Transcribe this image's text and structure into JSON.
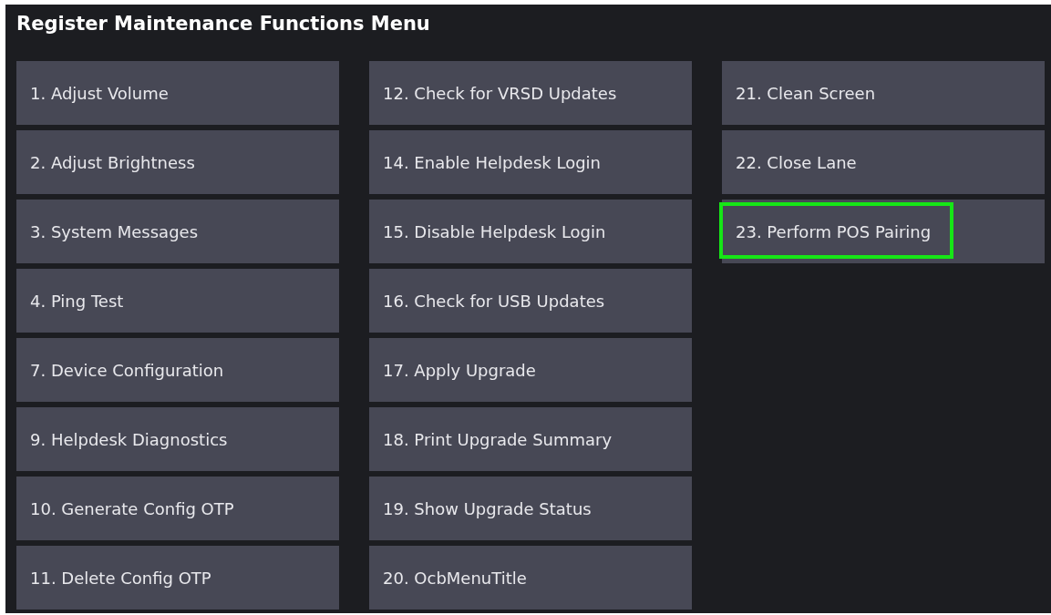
{
  "title": "Register Maintenance Functions Menu",
  "columns": [
    {
      "items": [
        {
          "label": "1. Adjust Volume",
          "highlighted": false
        },
        {
          "label": "2. Adjust Brightness",
          "highlighted": false
        },
        {
          "label": "3. System Messages",
          "highlighted": false
        },
        {
          "label": "4. Ping Test",
          "highlighted": false
        },
        {
          "label": "7. Device Configuration",
          "highlighted": false
        },
        {
          "label": "9. Helpdesk Diagnostics",
          "highlighted": false
        },
        {
          "label": "10. Generate Config OTP",
          "highlighted": false
        },
        {
          "label": "11. Delete Config OTP",
          "highlighted": false
        }
      ]
    },
    {
      "items": [
        {
          "label": "12. Check for VRSD Updates",
          "highlighted": false
        },
        {
          "label": "14. Enable Helpdesk Login",
          "highlighted": false
        },
        {
          "label": "15. Disable Helpdesk Login",
          "highlighted": false
        },
        {
          "label": "16. Check for USB Updates",
          "highlighted": false
        },
        {
          "label": "17. Apply Upgrade",
          "highlighted": false
        },
        {
          "label": "18. Print Upgrade Summary",
          "highlighted": false
        },
        {
          "label": "19. Show Upgrade Status",
          "highlighted": false
        },
        {
          "label": "20. OcbMenuTitle",
          "highlighted": false
        }
      ]
    },
    {
      "items": [
        {
          "label": "21. Clean Screen",
          "highlighted": false
        },
        {
          "label": "22. Close Lane",
          "highlighted": false
        },
        {
          "label": "23. Perform POS Pairing",
          "highlighted": true
        }
      ]
    }
  ]
}
